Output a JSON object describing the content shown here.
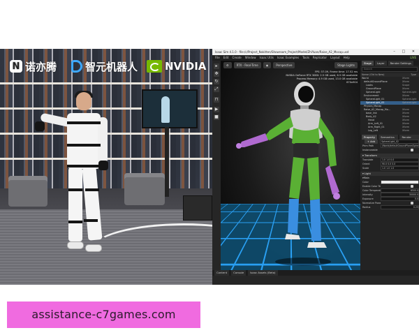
{
  "logos": {
    "nuoyiteng": "诺亦腾",
    "zhiyuan": "智元机器人",
    "nvidia": "NVIDIA"
  },
  "app": {
    "title": "Isaac Sim 4.1.0 - file:/c/Project_Nokitten/Showroom_Project/Model/ZhiYuan/Raise_A2_Mocap.usd",
    "window_controls": "–  □  ✕",
    "menus": [
      "File",
      "Edit",
      "Create",
      "Window",
      "Isaac Utils",
      "Isaac Examples",
      "Tools",
      "Replicator",
      "Layout",
      "Help"
    ],
    "menu_right": "LIVE",
    "viewport": {
      "camera_label": "RTX - Real-Time",
      "view_label": "Perspective",
      "stage_button": "Stage Lights",
      "stats": [
        "FPS: 57.09, Frame time: 17.52 ms",
        "NVIDIA GeForce RTX 3080: 2.5 GB used, 6.5 GB available",
        "Process Memory: 4.9 GB used, 13.0 GB available",
        "670x904"
      ]
    },
    "panel_tabs": [
      "Stage",
      "Layer",
      "Render Settings"
    ],
    "search_placeholder": "Search",
    "tree_headers": [
      "Name (Old to New)",
      "Type"
    ],
    "tree": [
      {
        "name": "World",
        "type": "Xform"
      },
      {
        "name": "defaultGroundPlane",
        "type": "Xform"
      },
      {
        "name": "Looks",
        "type": "Scope"
      },
      {
        "name": "GroundPlane",
        "type": "Xform"
      },
      {
        "name": "SphereLight",
        "type": "SphereLight"
      },
      {
        "name": "Environment",
        "type": "Xform"
      },
      {
        "name": "SphereLight_01",
        "type": "SphereLight"
      },
      {
        "name": "SphereLight_02",
        "type": "SphereLight"
      },
      {
        "name": "Physics_Mocap",
        "type": ""
      },
      {
        "name": "Raise_A2_Mocap_Mo...",
        "type": "Xform"
      },
      {
        "name": "base_link",
        "type": "Xform"
      },
      {
        "name": "Body_A2",
        "type": "Xform"
      },
      {
        "name": "Head",
        "type": "Xform"
      },
      {
        "name": "Arm_Left_01",
        "type": "Xform"
      },
      {
        "name": "Arm_Right_01",
        "type": "Xform"
      },
      {
        "name": "Leg_Left",
        "type": "Xform"
      }
    ],
    "property_tabs": [
      "Property",
      "Semantics Sch...",
      "Render Settings"
    ],
    "add_button": "Add",
    "prim_name": "SphereLight_02",
    "prim_path_label": "Prim Path",
    "prim_path": "/World/defaultGroundPlane/SphereLight_02",
    "instanceable_label": "Instanceable",
    "transform_header": "Transform",
    "transform_rows": [
      {
        "label": "Translate",
        "value": "1.0   1.0   0.0"
      },
      {
        "label": "Orient",
        "value": "90.0  0.0   0.0"
      },
      {
        "label": "Scale",
        "value": "1.0   1.0   1.0"
      }
    ],
    "light_header": "Light",
    "light_sub": "Main",
    "light_rows": [
      {
        "label": "Color",
        "value": ""
      },
      {
        "label": "Enable Color Temperature",
        "value": ""
      },
      {
        "label": "Color Temperature",
        "value": "6500.0"
      },
      {
        "label": "Intensity",
        "value": "30000.0"
      },
      {
        "label": "Exposure",
        "value": "0.0"
      },
      {
        "label": "Normalize Power",
        "value": ""
      },
      {
        "label": "Radius",
        "value": "0.25"
      }
    ],
    "bottom_tabs": [
      "Content",
      "Console",
      "Isaac Assets (Beta)"
    ]
  },
  "banner": {
    "text": "assistance-c7games.com"
  },
  "colors": {
    "banner_bg": "#f06be0",
    "nvidia_green": "#76b900",
    "grid_blue": "#2aa7ff",
    "robot_green": "#62b83a",
    "robot_blue": "#3a8ee0",
    "robot_purple": "#b06ad0",
    "selection": "#345f8a"
  }
}
